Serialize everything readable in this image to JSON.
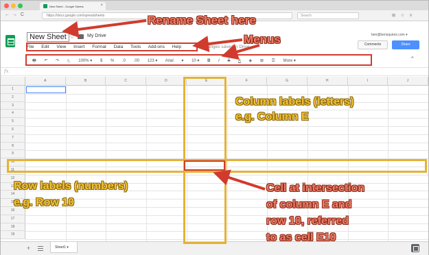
{
  "browser": {
    "tab_title": "New Sheet - Google Sheets",
    "tab_close": "×",
    "url": "https://docs.google.com/spreadsheets",
    "search_placeholder": "Search",
    "nav_back": "←",
    "nav_forward": "→",
    "nav_reload": "C",
    "extension_icons": "⊞ ☆ ≡"
  },
  "header": {
    "doc_title": "New Sheet",
    "star": "☆",
    "drive_label": "My Drive",
    "account_email": "ben@bensquires.com ▾",
    "comments_label": "Comments",
    "share_label": "Share"
  },
  "menus": [
    "File",
    "Edit",
    "View",
    "Insert",
    "Format",
    "Data",
    "Tools",
    "Add-ons",
    "Help"
  ],
  "last_edit": "All changes saved in Drive",
  "toolbar": [
    "🖶",
    "↶",
    "↷",
    "⎁",
    "100% ▾",
    "$",
    "%",
    ".0",
    ".00",
    "123 ▾",
    "Arial",
    "▾",
    "10 ▾",
    "B",
    "I",
    "S",
    "A",
    "◈",
    "⊞",
    "☰",
    "More ▾"
  ],
  "collapse_icon": "⌃",
  "formula_label": "fx",
  "columns": [
    "A",
    "B",
    "C",
    "D",
    "E",
    "F",
    "G",
    "H",
    "I",
    "J"
  ],
  "rows": [
    "1",
    "2",
    "3",
    "4",
    "5",
    "6",
    "7",
    "8",
    "9",
    "10",
    "11",
    "12",
    "13",
    "14",
    "15",
    "16",
    "17",
    "18",
    "19"
  ],
  "bottom": {
    "add_sheet": "+",
    "sheet_tab": "Sheet1 ▾"
  },
  "annotations": {
    "rename": "Rename Sheet here",
    "menus": "Menus",
    "column_line1": "Column labels (letters)",
    "column_line2": "e.g. Column E",
    "row_line1": "Row labels (numbers)",
    "row_line2": "e.g. Row 10",
    "cell_line1": "Cell at intersection",
    "cell_line2": "of column E and",
    "cell_line3": "row 10, referred",
    "cell_line4": "to as cell E10"
  },
  "colors": {
    "annotation_red": "#ef7c66",
    "annotation_gold": "#f5c233",
    "highlight_gold": "#e4b332",
    "highlight_red": "#d03b2d",
    "sheets_green": "#0f9d58",
    "share_blue": "#4d90fe"
  }
}
